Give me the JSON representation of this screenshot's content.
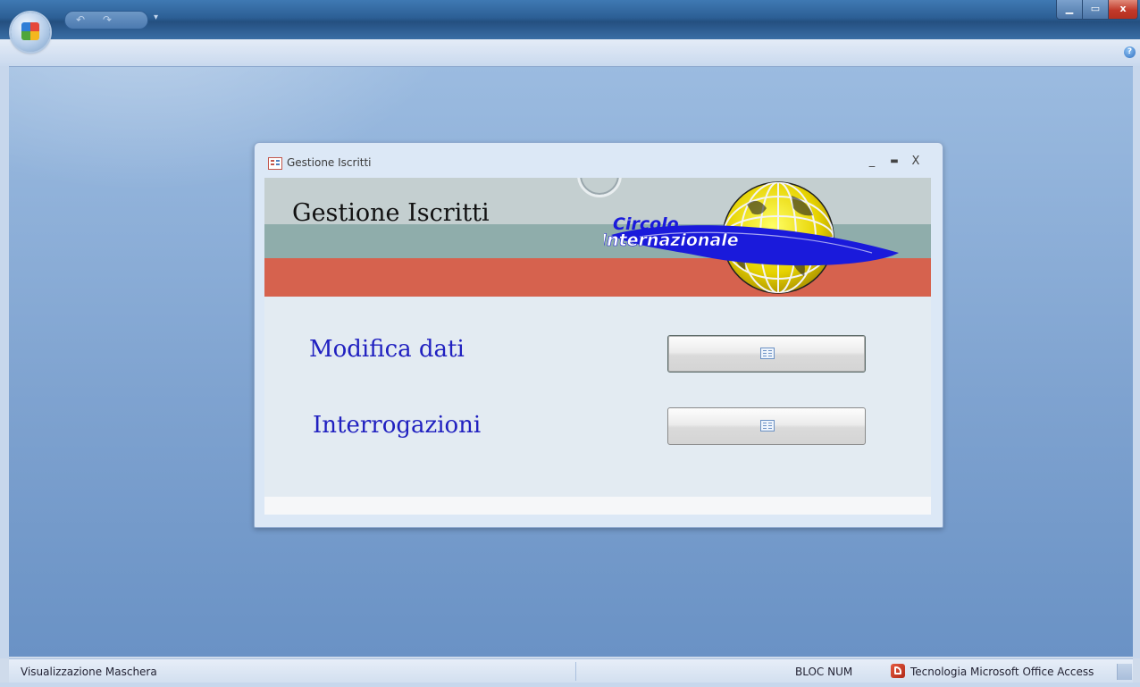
{
  "app": {
    "quick_access": [
      "↶",
      "↷"
    ],
    "qat_more": "▾",
    "window_controls": {
      "minimize": "▁",
      "maximize": "▭",
      "close": "x"
    },
    "help_glyph": "?"
  },
  "form": {
    "window_title": "Gestione Iscritti",
    "controls": {
      "minimize": "_",
      "maximize": "▬",
      "close": "X"
    },
    "header": {
      "title": "Gestione Iscritti",
      "logo_line1": "Circolo",
      "logo_line2": "Internazionale"
    },
    "menu": [
      {
        "label": "Modifica dati"
      },
      {
        "label": "Interrogazioni"
      }
    ]
  },
  "statusbar": {
    "left": "Visualizzazione Maschera",
    "bloc_num": "BLOC NUM",
    "technology": "Tecnologia Microsoft Office Access"
  },
  "colors": {
    "header_gray": "#c4cfd0",
    "header_teal": "#8fadab",
    "header_red": "#d6624e",
    "label_blue": "#2020c0",
    "workspace": "#7fa3d0"
  },
  "icons": [
    "office-button-icon",
    "undo-icon",
    "redo-icon",
    "help-icon",
    "form-icon",
    "globe-logo-icon",
    "access-icon"
  ]
}
